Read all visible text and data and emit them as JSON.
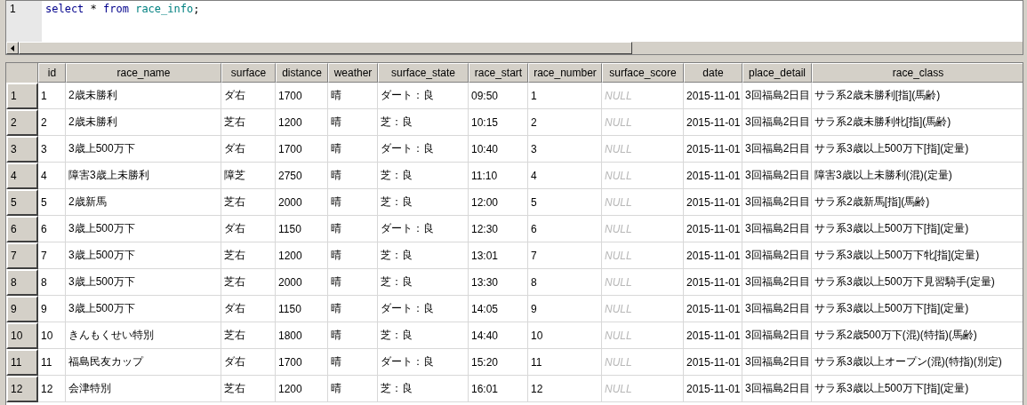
{
  "editor": {
    "lines": [
      {
        "number": "1",
        "tokens": [
          {
            "text": "select",
            "kind": "keyword"
          },
          {
            "text": " * ",
            "kind": "plain"
          },
          {
            "text": "from ",
            "kind": "keyword"
          },
          {
            "text": "race_info",
            "kind": "identifier"
          },
          {
            "text": ";",
            "kind": "plain"
          }
        ]
      }
    ]
  },
  "table": {
    "columns": [
      "id",
      "race_name",
      "surface",
      "distance",
      "weather",
      "surface_state",
      "race_start",
      "race_number",
      "surface_score",
      "date",
      "place_detail",
      "race_class"
    ],
    "rows": [
      {
        "row_number": "1",
        "cells": [
          "1",
          "2歳未勝利",
          "ダ右",
          "1700",
          "晴",
          "ダート：良",
          "09:50",
          "1",
          {
            "text": "NULL",
            "null": true
          },
          "2015-11-01",
          "3回福島2日目",
          "サラ系2歳未勝利[指](馬齢)"
        ]
      },
      {
        "row_number": "2",
        "cells": [
          "2",
          "2歳未勝利",
          "芝右",
          "1200",
          "晴",
          "芝：良",
          "10:15",
          "2",
          {
            "text": "NULL",
            "null": true
          },
          "2015-11-01",
          "3回福島2日目",
          "サラ系2歳未勝利牝[指](馬齢)"
        ]
      },
      {
        "row_number": "3",
        "cells": [
          "3",
          "3歳上500万下",
          "ダ右",
          "1700",
          "晴",
          "ダート：良",
          "10:40",
          "3",
          {
            "text": "NULL",
            "null": true
          },
          "2015-11-01",
          "3回福島2日目",
          "サラ系3歳以上500万下[指](定量)"
        ]
      },
      {
        "row_number": "4",
        "cells": [
          "4",
          "障害3歳上未勝利",
          "障芝",
          "2750",
          "晴",
          "芝：良",
          "11:10",
          "4",
          {
            "text": "NULL",
            "null": true
          },
          "2015-11-01",
          "3回福島2日目",
          "障害3歳以上未勝利(混)(定量)"
        ]
      },
      {
        "row_number": "5",
        "cells": [
          "5",
          "2歳新馬",
          "芝右",
          "2000",
          "晴",
          "芝：良",
          "12:00",
          "5",
          {
            "text": "NULL",
            "null": true
          },
          "2015-11-01",
          "3回福島2日目",
          "サラ系2歳新馬[指](馬齢)"
        ]
      },
      {
        "row_number": "6",
        "cells": [
          "6",
          "3歳上500万下",
          "ダ右",
          "1150",
          "晴",
          "ダート：良",
          "12:30",
          "6",
          {
            "text": "NULL",
            "null": true
          },
          "2015-11-01",
          "3回福島2日目",
          "サラ系3歳以上500万下[指](定量)"
        ]
      },
      {
        "row_number": "7",
        "cells": [
          "7",
          "3歳上500万下",
          "芝右",
          "1200",
          "晴",
          "芝：良",
          "13:01",
          "7",
          {
            "text": "NULL",
            "null": true
          },
          "2015-11-01",
          "3回福島2日目",
          "サラ系3歳以上500万下牝[指](定量)"
        ]
      },
      {
        "row_number": "8",
        "cells": [
          "8",
          "3歳上500万下",
          "芝右",
          "2000",
          "晴",
          "芝：良",
          "13:30",
          "8",
          {
            "text": "NULL",
            "null": true
          },
          "2015-11-01",
          "3回福島2日目",
          "サラ系3歳以上500万下見習騎手(定量)"
        ]
      },
      {
        "row_number": "9",
        "cells": [
          "9",
          "3歳上500万下",
          "ダ右",
          "1150",
          "晴",
          "ダート：良",
          "14:05",
          "9",
          {
            "text": "NULL",
            "null": true
          },
          "2015-11-01",
          "3回福島2日目",
          "サラ系3歳以上500万下[指](定量)"
        ]
      },
      {
        "row_number": "10",
        "cells": [
          "10",
          "きんもくせい特別",
          "芝右",
          "1800",
          "晴",
          "芝：良",
          "14:40",
          "10",
          {
            "text": "NULL",
            "null": true
          },
          "2015-11-01",
          "3回福島2日目",
          "サラ系2歳500万下(混)(特指)(馬齢)"
        ]
      },
      {
        "row_number": "11",
        "cells": [
          "11",
          "福島民友カップ",
          "ダ右",
          "1700",
          "晴",
          "ダート：良",
          "15:20",
          "11",
          {
            "text": "NULL",
            "null": true
          },
          "2015-11-01",
          "3回福島2日目",
          "サラ系3歳以上オープン(混)(特指)(別定)"
        ]
      },
      {
        "row_number": "12",
        "cells": [
          "12",
          "会津特別",
          "芝右",
          "1200",
          "晴",
          "芝：良",
          "16:01",
          "12",
          {
            "text": "NULL",
            "null": true
          },
          "2015-11-01",
          "3回福島2日目",
          "サラ系3歳以上500万下[指](定量)"
        ]
      }
    ]
  }
}
